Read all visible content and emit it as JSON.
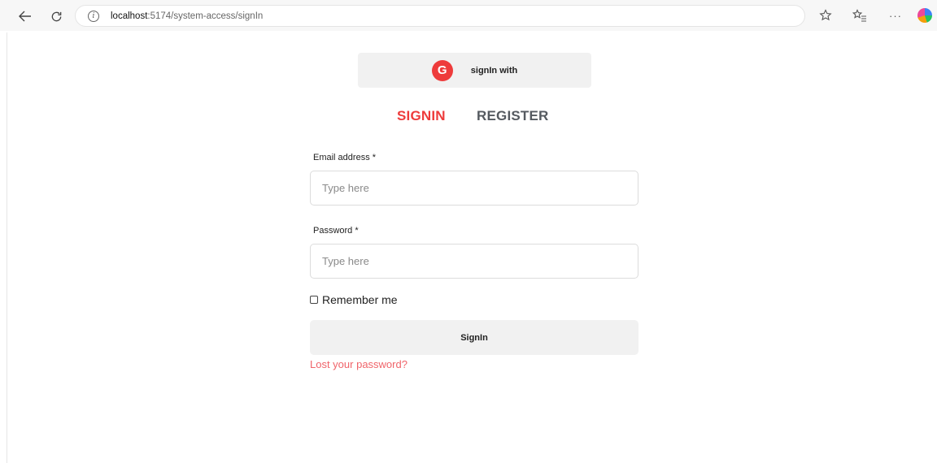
{
  "browser": {
    "url_host": "localhost",
    "url_rest": ":5174/system-access/signIn",
    "icons": {
      "back": "arrow-left-icon",
      "reload": "reload-icon",
      "info": "info-icon",
      "favorite": "star-icon",
      "favorites_bar": "favorites-icon",
      "more": "ellipsis-icon",
      "copilot": "copilot-icon"
    }
  },
  "social_login": {
    "icon_letter": "G",
    "label": "signIn with",
    "icon_color": "#ee3b3b"
  },
  "tabs": [
    {
      "label": "SIGNIN",
      "active": true
    },
    {
      "label": "REGISTER",
      "active": false
    }
  ],
  "form": {
    "email": {
      "label": "Email address *",
      "placeholder": "Type here",
      "value": ""
    },
    "password": {
      "label": "Password *",
      "placeholder": "Type here",
      "value": ""
    },
    "remember": {
      "label": "Remember me",
      "checked": false
    },
    "submit_label": "SignIn",
    "lost_password": "Lost your password?"
  },
  "colors": {
    "accent": "#ee3b3b",
    "link": "#f0646a",
    "button_bg": "#f1f1f1"
  }
}
